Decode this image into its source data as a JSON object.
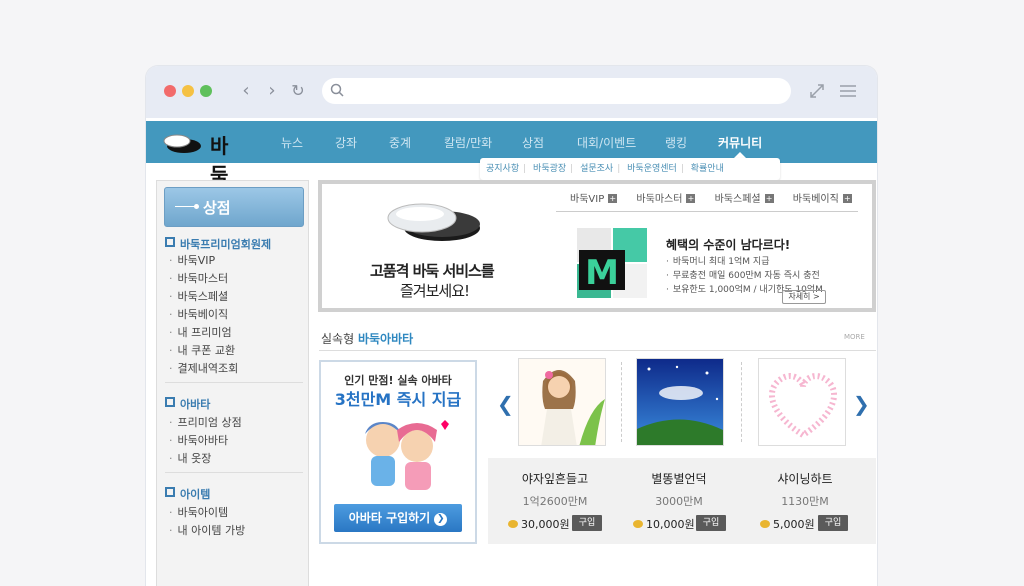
{
  "site": {
    "logo_text": "바둑",
    "nav": [
      "뉴스",
      "강좌",
      "중계",
      "칼럼/만화",
      "상점",
      "대회/이벤트",
      "랭킹",
      "커뮤니티"
    ],
    "submenu": [
      "공지사항",
      "바둑광장",
      "설문조사",
      "바둑운영센터",
      "확률안내"
    ]
  },
  "sidebar": {
    "shop_label": "상점",
    "sections": [
      {
        "title": "바둑프리미엄회원제",
        "items": [
          "바둑VIP",
          "바둑마스터",
          "바둑스페셜",
          "바둑베이직",
          "내 프리미엄",
          "내 쿠폰 교환",
          "결제내역조회"
        ]
      },
      {
        "title": "아바타",
        "items": [
          "프리미엄 상점",
          "바둑아바타",
          "내 옷장"
        ]
      },
      {
        "title": "아이템",
        "items": [
          "바둑아이템",
          "내 아이템 가방"
        ]
      }
    ]
  },
  "banner": {
    "headline1": "고품격 바둑 서비스를",
    "headline2": "즐겨보세요!",
    "tabs": [
      "바둑VIP",
      "바둑마스터",
      "바둑스페셜",
      "바둑베이직"
    ],
    "tile_letter": "M",
    "promo_title": "혜택의 수준이 남다르다!",
    "promo_lines": [
      "바둑머니 최대 1억M 지급",
      "무료충전 매일 600만M 자동 즉시 충전",
      "보유한도 1,000억M / 내기한도 10억M"
    ],
    "more_label": "자세히 >"
  },
  "avatar_section": {
    "title_prefix": "실속형",
    "title_highlight": "바둑아바타",
    "more": "MORE",
    "box_line1": "인기 만점! 실속 아바타",
    "box_line2": "3천만M 즉시 지급",
    "buy_button": "아바타 구입하기",
    "products": [
      {
        "name": "야자잎흔들고",
        "money": "1억2600만M",
        "price": "30,000원",
        "buy": "구입"
      },
      {
        "name": "별똥별언덕",
        "money": "3000만M",
        "price": "10,000원",
        "buy": "구입"
      },
      {
        "name": "샤이닝하트",
        "money": "1130만M",
        "price": "5,000원",
        "buy": "구입"
      }
    ]
  }
}
